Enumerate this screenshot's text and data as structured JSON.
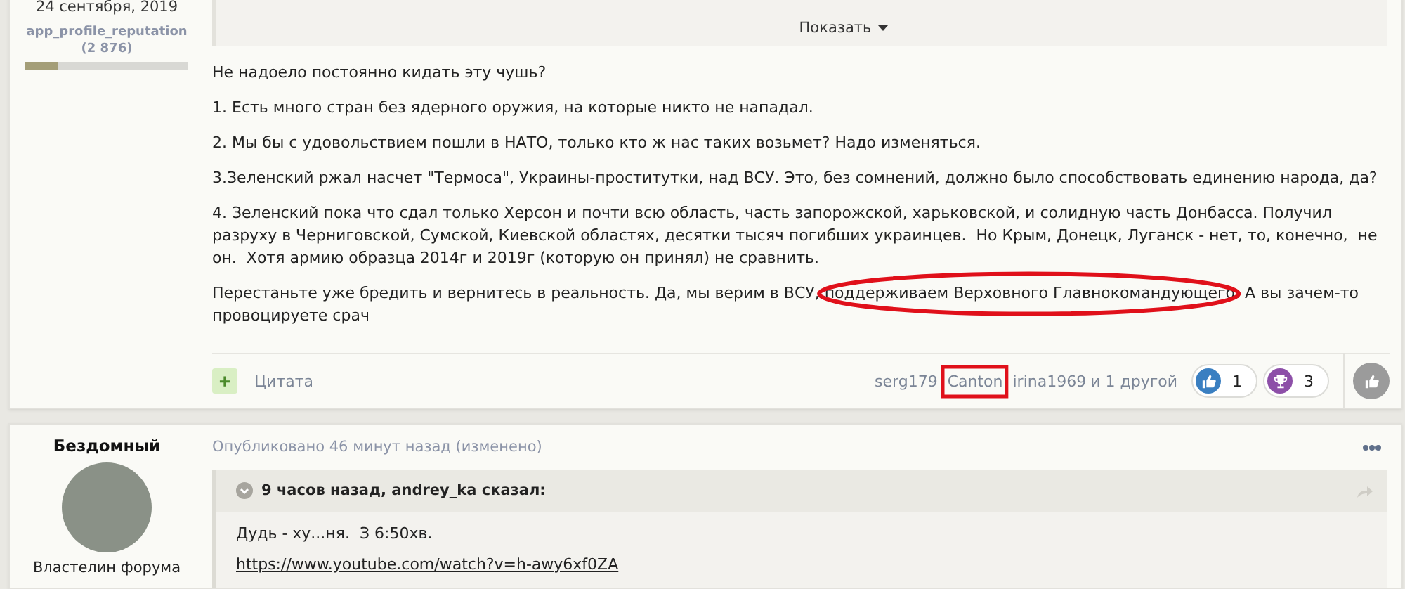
{
  "first_post": {
    "author": {
      "date": "24 сентября, 2019",
      "reputation_label": "app_profile_reputation",
      "reputation": "(2 876)",
      "reputation_bar": {
        "level": 0.2
      }
    },
    "quote": {
      "toggle": "Показать"
    },
    "paragraphs": [
      {
        "text": "Не надоело постоянно кидать эту чушь?"
      },
      {
        "text": "1. Есть много стран без ядерного оружия, на которые никто не нападал."
      },
      {
        "text": "2. Мы бы с удовольствием пошли в НАТО, только кто ж нас таких возьмет? Надо изменяться."
      },
      {
        "text": "3.Зеленский ржал насчет \"Термоса\", Украины-проститутки, над ВСУ. Это, без сомнений, должно было способствовать единению народа, да?"
      },
      {
        "text": "4. Зеленский пока что сдал только Херсон и почти всю область, часть запорожской, харьковской, и солидную часть Донбасса. Получил разруху в Черниговской, Сумской, Киевской областях, десятки тысяч погибших украинцев.  Но Крым, Донецк, Луганск - нет, то, конечно,  не он.  Хотя армию образца 2014г и 2019г (которую он принял) не сравнить."
      },
      {
        "segments": [
          {
            "text": "Перестаньте уже бредить и вернитесь в реальность. Да, мы верим в ВСУ, "
          },
          {
            "text": "поддерживаем Верховного Главнокомандующего.",
            "circled": true
          },
          {
            "text": " А вы зачем-то провоцируете срач"
          }
        ]
      }
    ],
    "footer": {
      "add_label": "+",
      "quote_button": "Цитата",
      "reactors": [
        {
          "name": "serg179",
          "boxed": false
        },
        {
          "name": "Canton",
          "boxed": true
        },
        {
          "name": "irina1969",
          "boxed": false
        }
      ],
      "others": "и 1 другой",
      "reactions": [
        {
          "kind": "like",
          "count": "1",
          "color": "#3a7fc1"
        },
        {
          "kind": "trophy",
          "count": "3",
          "color": "#8d4fa8"
        }
      ]
    }
  },
  "second_post": {
    "author": {
      "name": "Бездомный",
      "rank": "Властелин форума"
    },
    "meta": "Опубликовано 46 минут назад (изменено)",
    "quote": {
      "header": "9 часов назад, andrey_ka сказал:",
      "lines": [
        {
          "kind": "text",
          "text": "Дудь - ху...ня.  З 6:50хв."
        },
        {
          "kind": "link",
          "text": "https://www.youtube.com/watch?v=h-awy6xf0ZA"
        }
      ]
    }
  }
}
